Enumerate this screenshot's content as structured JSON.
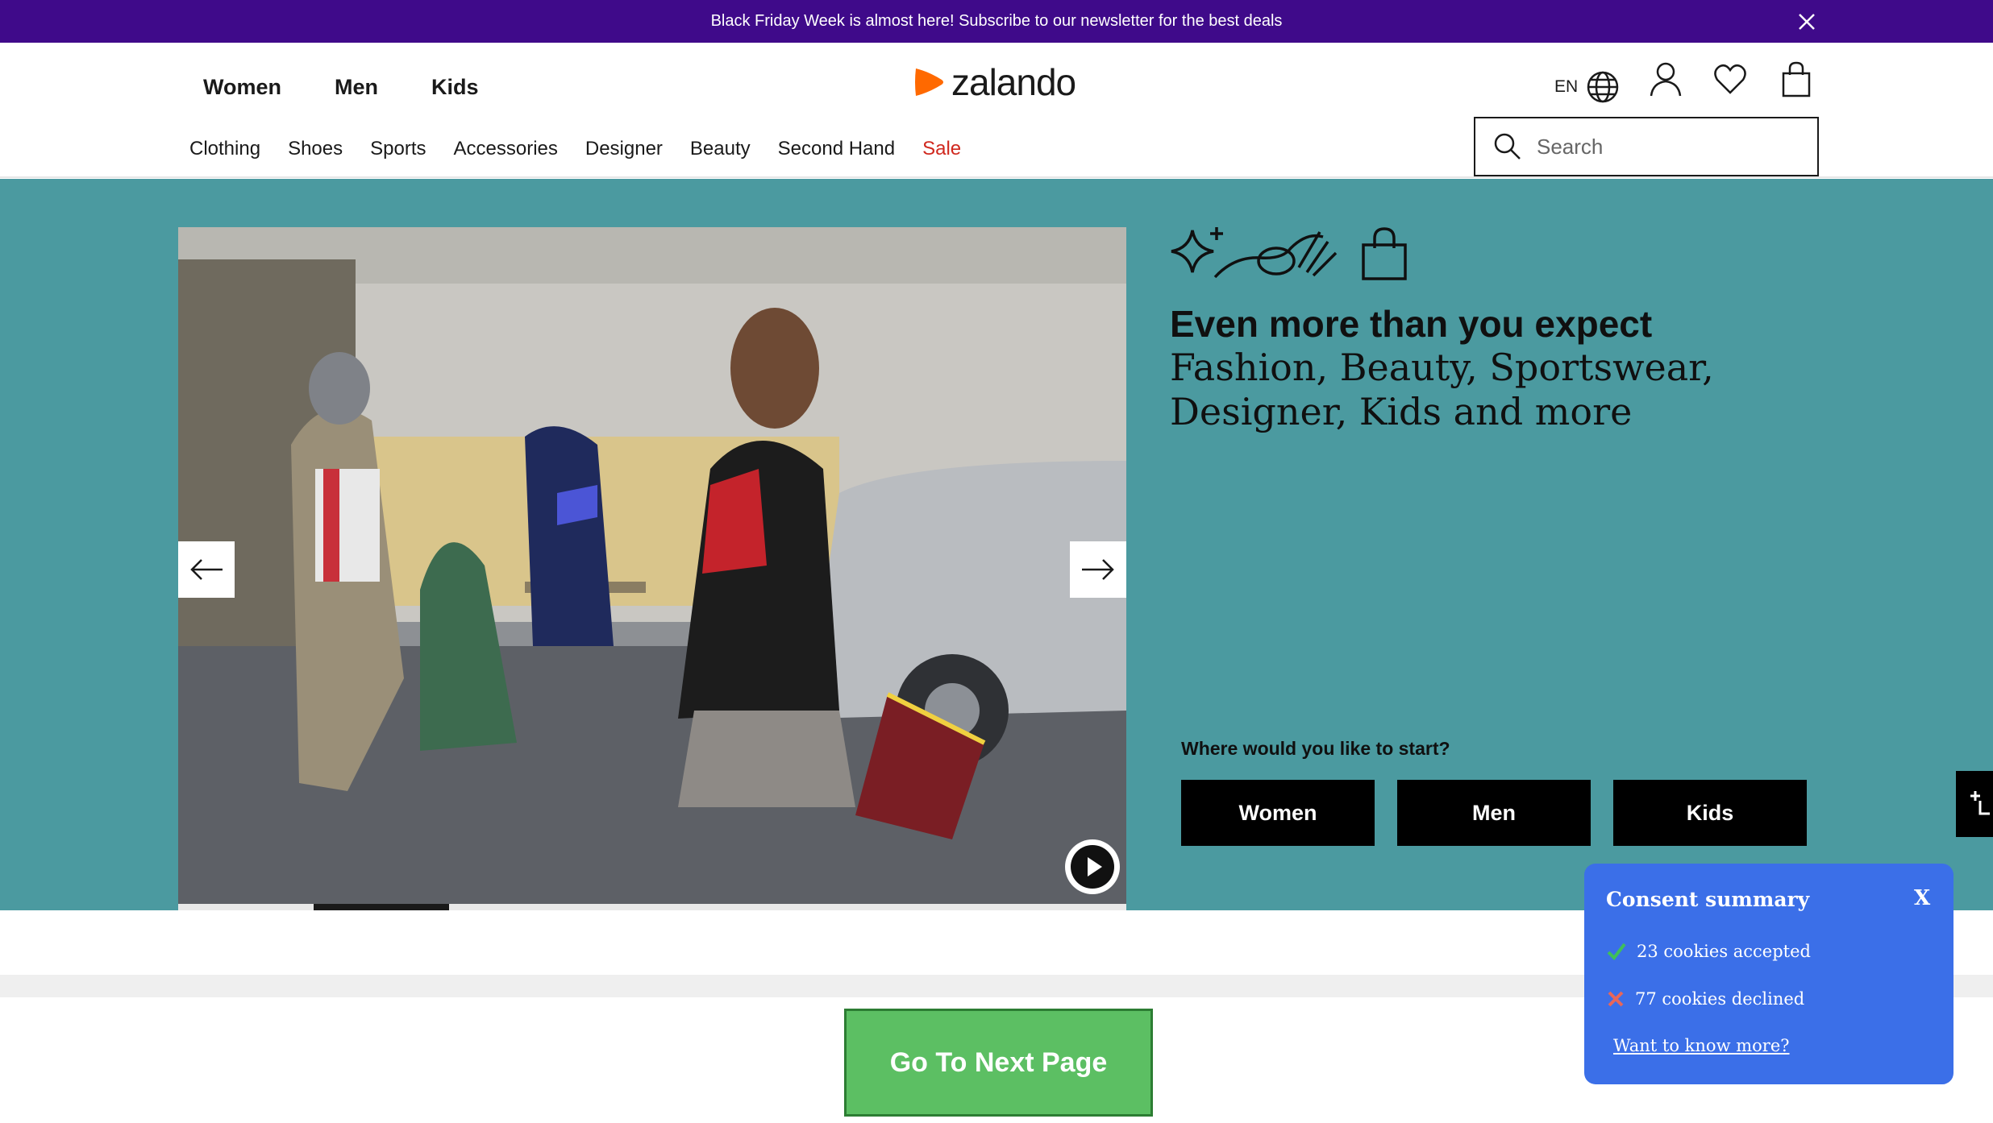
{
  "banner": {
    "text": "Black Friday Week is almost here! Subscribe to our newsletter for the best deals"
  },
  "header": {
    "gender_nav": [
      "Women",
      "Men",
      "Kids"
    ],
    "logo_text": "zalando",
    "language": "EN",
    "category_nav": [
      "Clothing",
      "Shoes",
      "Sports",
      "Accessories",
      "Designer",
      "Beauty",
      "Second Hand",
      "Sale"
    ],
    "search_placeholder": "Search",
    "icons": [
      "globe-icon",
      "account-icon",
      "wishlist-heart-icon",
      "shopping-bag-icon",
      "search-icon"
    ]
  },
  "hero": {
    "headline": "Even more than you expect",
    "subline": "Fashion, Beauty, Sportswear, Designer, Kids and more",
    "start_question": "Where would you like to start?",
    "start_buttons": [
      "Women",
      "Men",
      "Kids"
    ],
    "carousel_active_slide": 2,
    "background_color": "#4b9aa0"
  },
  "next_page_button": "Go To Next Page",
  "consent": {
    "title": "Consent summary",
    "close": "X",
    "accepted": "23 cookies accepted",
    "declined": "77 cookies declined",
    "link": "Want to know more?"
  },
  "colors": {
    "banner": "#3f0a8a",
    "brand_orange": "#ff6900",
    "sale_red": "#d0281e",
    "consent_blue": "#3b6fe8",
    "next_green": "#5cbf63"
  }
}
